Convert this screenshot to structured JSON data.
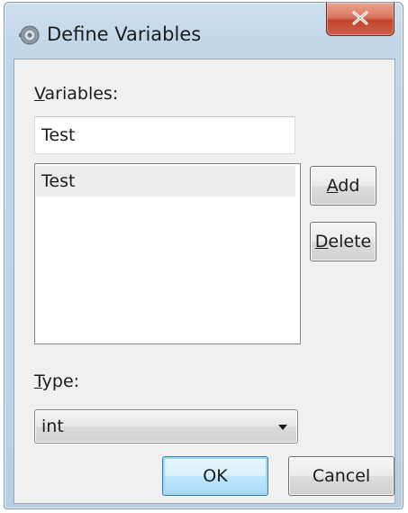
{
  "window": {
    "title": "Define Variables",
    "close_label": "X"
  },
  "variables": {
    "label_accel": "V",
    "label_rest": "ariables:",
    "input_value": "Test",
    "items": [
      "Test"
    ]
  },
  "buttons": {
    "add_accel": "A",
    "add_rest": "dd",
    "delete_accel": "D",
    "delete_rest": "elete",
    "ok": "OK",
    "cancel": "Cancel"
  },
  "type": {
    "label_accel": "T",
    "label_rest": "ype:",
    "selected": "int"
  },
  "icons": {
    "app": "gear-app-icon",
    "close": "close-icon",
    "dropdown": "chevron-down-icon"
  },
  "colors": {
    "title_bar": "#c2d6e8",
    "close_button": "#c0432b",
    "dialog_bg": "#f0f0f0",
    "default_button_border": "#3c7fb1"
  }
}
